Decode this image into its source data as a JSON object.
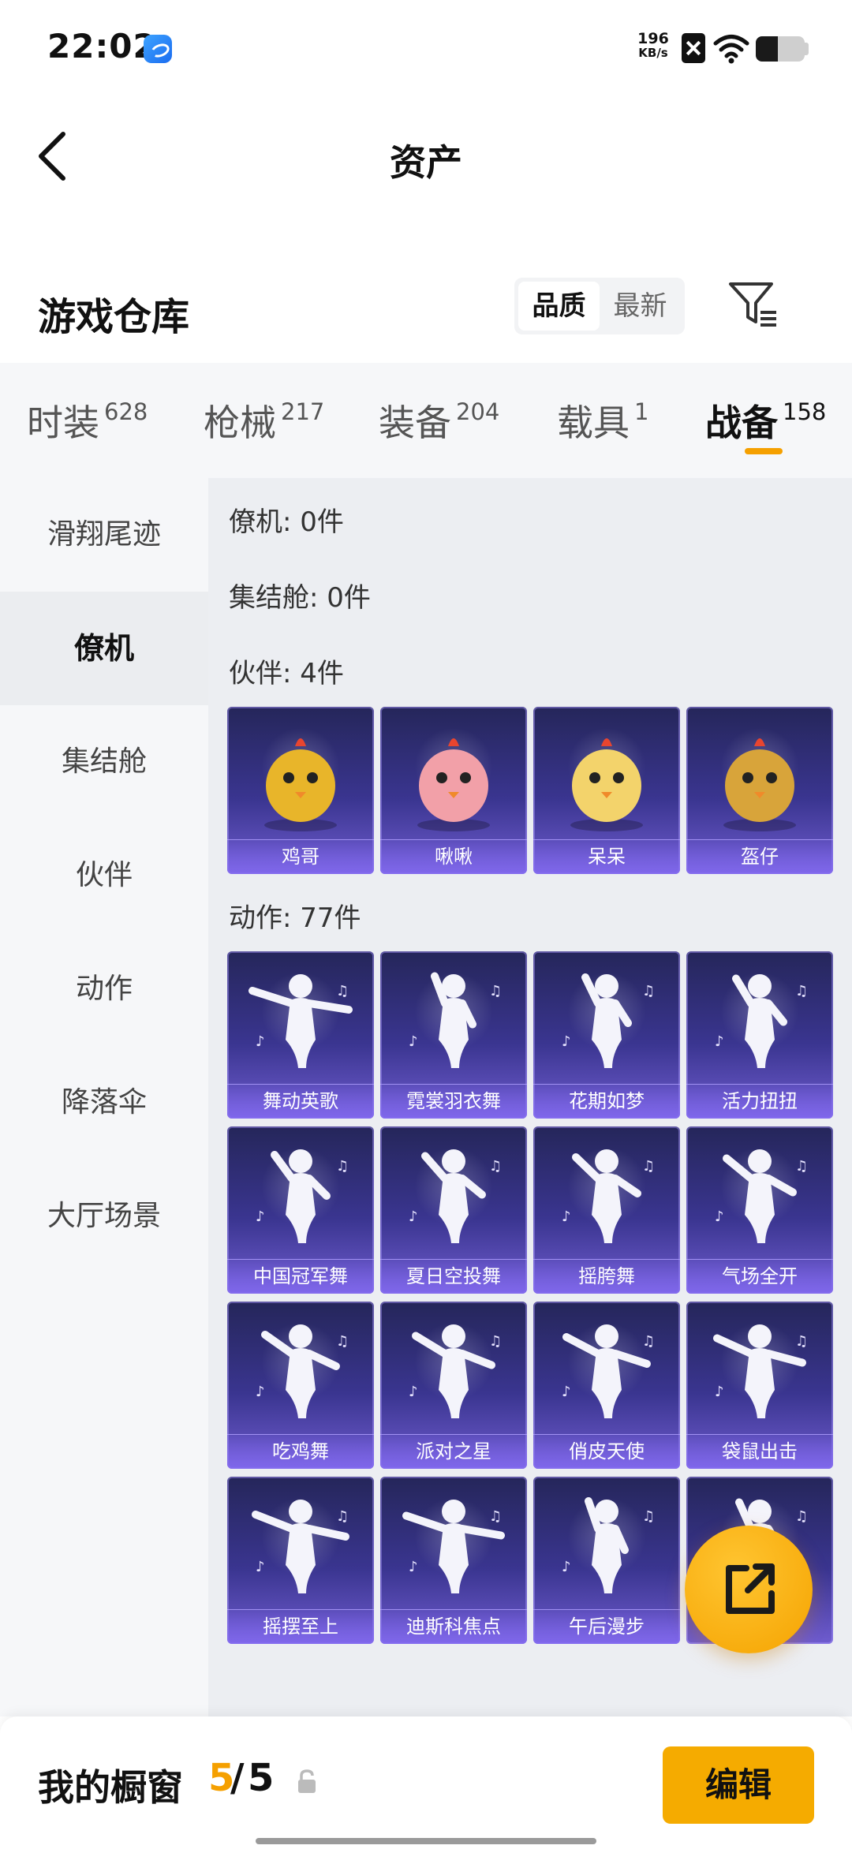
{
  "status_bar": {
    "time": "22:02",
    "net_speed_value": "196",
    "net_speed_unit": "KB/s",
    "icons": [
      "app-icon",
      "sim-off-icon",
      "wifi-icon",
      "battery-icon"
    ],
    "battery_level": 0.45
  },
  "header": {
    "title": "资产"
  },
  "section": {
    "title": "游戏仓库",
    "sort_options": [
      "品质",
      "最新"
    ],
    "sort_selected": "品质"
  },
  "category_tabs": [
    {
      "label": "时装",
      "count": "628"
    },
    {
      "label": "枪械",
      "count": "217"
    },
    {
      "label": "装备",
      "count": "204"
    },
    {
      "label": "载具",
      "count": "1"
    },
    {
      "label": "战备",
      "count": "158",
      "active": true
    }
  ],
  "sidebar": {
    "items": [
      "滑翔尾迹",
      "僚机",
      "集结舱",
      "伙伴",
      "动作",
      "降落伞",
      "大厅场景"
    ],
    "active": "僚机"
  },
  "groups": {
    "wingman": "僚机: 0件",
    "assembly": "集结舱: 0件",
    "partners": "伙伴: 4件",
    "actions": "动作: 77件"
  },
  "partners": [
    "鸡哥",
    "啾啾",
    "呆呆",
    "盔仔"
  ],
  "actions": [
    "舞动英歌",
    "霓裳羽衣舞",
    "花期如梦",
    "活力扭扭",
    "中国冠军舞",
    "夏日空投舞",
    "摇胯舞",
    "气场全开",
    "吃鸡舞",
    "派对之星",
    "俏皮天使",
    "袋鼠出击",
    "摇摆至上",
    "迪斯科焦点",
    "午后漫步",
    ""
  ],
  "bottom_bar": {
    "showcase_label": "我的橱窗",
    "used": "5",
    "separator": "/",
    "total": "5",
    "edit_label": "编辑"
  },
  "colors": {
    "accent": "#f5a000",
    "card_top": "#25265a",
    "card_bottom": "#6f5ccf"
  }
}
